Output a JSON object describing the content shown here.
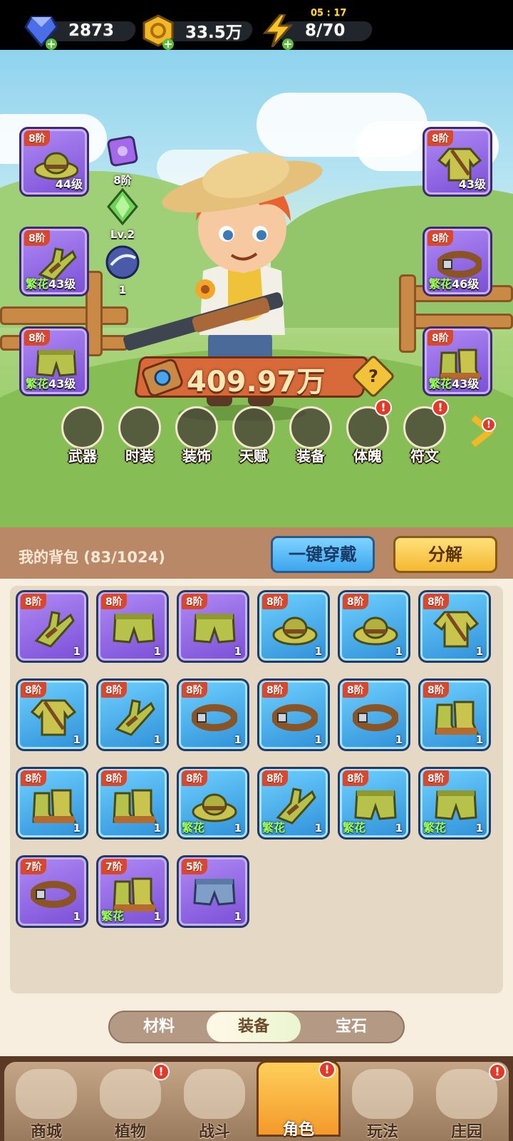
{
  "resources": {
    "gems": "2873",
    "gold": "33.5万",
    "energy": "8/70",
    "energy_timer": "05 : 17"
  },
  "equipped_left": [
    {
      "tier": "8阶",
      "level": "44级",
      "prefix": "",
      "icon": "hat-icon"
    },
    {
      "tier": "8阶",
      "level": "43级",
      "prefix": "繁花",
      "icon": "glove-icon"
    },
    {
      "tier": "8阶",
      "level": "43级",
      "prefix": "繁花",
      "icon": "pants-icon"
    }
  ],
  "equipped_right": [
    {
      "tier": "8阶",
      "level": "43级",
      "prefix": "",
      "icon": "shirt-icon"
    },
    {
      "tier": "8阶",
      "level": "46级",
      "prefix": "繁花",
      "icon": "belt-icon"
    },
    {
      "tier": "8阶",
      "level": "43级",
      "prefix": "繁花",
      "icon": "boots-icon"
    }
  ],
  "side_icons": [
    {
      "name": "tome-icon",
      "label": "8阶"
    },
    {
      "name": "crystal-icon",
      "label": "Lv.2"
    },
    {
      "name": "orb-icon",
      "label": "1"
    }
  ],
  "power": "409.97万",
  "help": "?",
  "feature_tabs": [
    {
      "label": "武器",
      "icon": "weapon-icon",
      "alert": false
    },
    {
      "label": "时装",
      "icon": "costume-icon",
      "alert": false
    },
    {
      "label": "装饰",
      "icon": "mask-icon",
      "alert": false
    },
    {
      "label": "天赋",
      "icon": "talent-icon",
      "alert": false
    },
    {
      "label": "装备",
      "icon": "equipment-icon",
      "alert": false
    },
    {
      "label": "体魄",
      "icon": "physique-icon",
      "alert": true
    },
    {
      "label": "符文",
      "icon": "rune-icon",
      "alert": true
    }
  ],
  "alert_mark": "!",
  "bag": {
    "title": "我的背包 (83/1024)",
    "equip_all": "一键穿戴",
    "decompose": "分解",
    "items": [
      {
        "tier": "8阶",
        "count": "1",
        "rarity": "purple",
        "prefix": "",
        "icon": "glove-icon"
      },
      {
        "tier": "8阶",
        "count": "1",
        "rarity": "purple",
        "prefix": "",
        "icon": "pants-icon"
      },
      {
        "tier": "8阶",
        "count": "1",
        "rarity": "purple",
        "prefix": "",
        "icon": "pants-icon"
      },
      {
        "tier": "8阶",
        "count": "1",
        "rarity": "blue",
        "prefix": "",
        "icon": "hat-icon"
      },
      {
        "tier": "8阶",
        "count": "1",
        "rarity": "blue",
        "prefix": "",
        "icon": "hat-icon"
      },
      {
        "tier": "8阶",
        "count": "1",
        "rarity": "blue",
        "prefix": "",
        "icon": "shirt-icon"
      },
      {
        "tier": "8阶",
        "count": "1",
        "rarity": "blue",
        "prefix": "",
        "icon": "shirt-icon"
      },
      {
        "tier": "8阶",
        "count": "1",
        "rarity": "blue",
        "prefix": "",
        "icon": "glove-icon"
      },
      {
        "tier": "8阶",
        "count": "1",
        "rarity": "blue",
        "prefix": "",
        "icon": "belt-icon"
      },
      {
        "tier": "8阶",
        "count": "1",
        "rarity": "blue",
        "prefix": "",
        "icon": "belt-icon"
      },
      {
        "tier": "8阶",
        "count": "1",
        "rarity": "blue",
        "prefix": "",
        "icon": "belt-icon"
      },
      {
        "tier": "8阶",
        "count": "1",
        "rarity": "blue",
        "prefix": "",
        "icon": "boots-icon"
      },
      {
        "tier": "8阶",
        "count": "1",
        "rarity": "blue",
        "prefix": "",
        "icon": "boots-icon"
      },
      {
        "tier": "8阶",
        "count": "1",
        "rarity": "blue",
        "prefix": "",
        "icon": "boots-icon"
      },
      {
        "tier": "8阶",
        "count": "1",
        "rarity": "blue",
        "prefix": "繁花",
        "icon": "hat-icon"
      },
      {
        "tier": "8阶",
        "count": "1",
        "rarity": "blue",
        "prefix": "繁花",
        "icon": "glove-icon"
      },
      {
        "tier": "8阶",
        "count": "1",
        "rarity": "blue",
        "prefix": "繁花",
        "icon": "pants-icon"
      },
      {
        "tier": "8阶",
        "count": "1",
        "rarity": "blue",
        "prefix": "繁花",
        "icon": "pants-icon"
      },
      {
        "tier": "7阶",
        "count": "1",
        "rarity": "purple",
        "prefix": "",
        "icon": "belt-icon"
      },
      {
        "tier": "7阶",
        "count": "1",
        "rarity": "purple",
        "prefix": "繁花",
        "icon": "boots-icon"
      },
      {
        "tier": "5阶",
        "count": "1",
        "rarity": "purple",
        "prefix": "",
        "icon": "shorts-icon"
      }
    ],
    "categories": [
      "材料",
      "装备",
      "宝石"
    ],
    "active_category": "装备"
  },
  "nav": [
    {
      "label": "商城",
      "icon": "shop-icon",
      "alert": false
    },
    {
      "label": "植物",
      "icon": "plant-icon",
      "alert": true
    },
    {
      "label": "战斗",
      "icon": "battle-icon",
      "alert": false
    },
    {
      "label": "角色",
      "icon": "character-icon",
      "alert": true,
      "active": true
    },
    {
      "label": "玩法",
      "icon": "gameplay-icon",
      "alert": false
    },
    {
      "label": "庄园",
      "icon": "manor-icon",
      "alert": true
    }
  ],
  "colors": {
    "purple_rarity": "#8d62e4",
    "blue_rarity": "#3ea2e6",
    "tier_badge": "#d9482c",
    "fanhua_text": "#9dff5a",
    "alert": "#e23a2a"
  }
}
